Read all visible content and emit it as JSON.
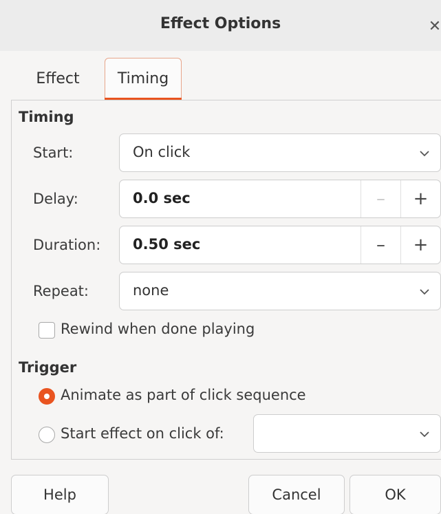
{
  "dialog": {
    "title": "Effect Options",
    "close_icon": "close-icon"
  },
  "tabs": [
    {
      "label": "Effect",
      "active": false
    },
    {
      "label": "Timing",
      "active": true
    }
  ],
  "timing": {
    "section_title": "Timing",
    "start": {
      "label": "Start:",
      "value": "On click"
    },
    "delay": {
      "label": "Delay:",
      "value": "0.0 sec",
      "minus": "–",
      "plus": "+"
    },
    "duration": {
      "label": "Duration:",
      "value": "0.50 sec",
      "minus": "–",
      "plus": "+"
    },
    "repeat": {
      "label": "Repeat:",
      "value": "none"
    },
    "rewind": {
      "label": "Rewind when done playing",
      "checked": false
    }
  },
  "trigger": {
    "section_title": "Trigger",
    "option_sequence": {
      "label": "Animate as part of click sequence",
      "selected": true
    },
    "option_click_of": {
      "label": "Start effect on click of:",
      "selected": false,
      "value": ""
    }
  },
  "footer": {
    "help_label": "Help",
    "cancel_label": "Cancel",
    "ok_label": "OK"
  },
  "colors": {
    "accent": "#e95420",
    "background": "#f6f5f4",
    "titlebar": "#ececec"
  }
}
